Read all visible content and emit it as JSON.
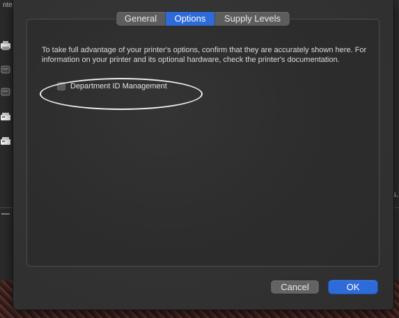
{
  "background_window": {
    "left_edge_text": "nte",
    "right_edge_text": "s."
  },
  "tabs": [
    {
      "label": "General",
      "active": false
    },
    {
      "label": "Options",
      "active": true
    },
    {
      "label": "Supply Levels",
      "active": false
    }
  ],
  "content": {
    "description": "To take full advantage of your printer's options, confirm that they are accurately shown here. For information on your printer and its optional hardware, check the printer's documentation.",
    "options": [
      {
        "label": "Department ID Management",
        "checked": false
      }
    ]
  },
  "buttons": {
    "cancel_label": "Cancel",
    "ok_label": "OK"
  },
  "colors": {
    "accent": "#2f6bd8",
    "sheet_background": "#333333"
  },
  "icons": {
    "background_printer": "printer-icon",
    "annotation": "highlight-ellipse"
  }
}
